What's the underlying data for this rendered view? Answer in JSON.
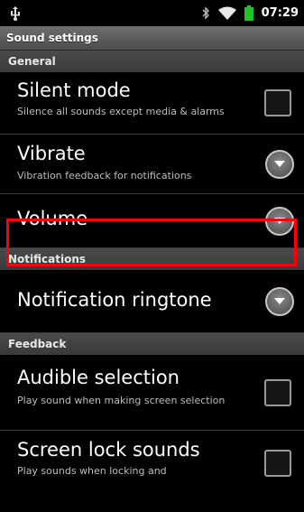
{
  "status_bar": {
    "time": "07:29",
    "icons": [
      "usb-icon",
      "bluetooth-icon",
      "wifi-icon",
      "battery-icon"
    ],
    "battery_color": "#22c322"
  },
  "title": "Sound settings",
  "sections": {
    "general": "General",
    "notifications": "Notifications",
    "feedback": "Feedback"
  },
  "items": {
    "silent_mode": {
      "title": "Silent mode",
      "summary": "Silence all sounds except media & alarms",
      "checked": false
    },
    "vibrate": {
      "title": "Vibrate",
      "summary": "Vibration feedback for notifications"
    },
    "volume": {
      "title": "Volume"
    },
    "notification_ringtone": {
      "title": "Notification ringtone"
    },
    "audible_selection": {
      "title": "Audible selection",
      "summary": "Play sound when making screen selection",
      "checked": false
    },
    "screen_lock_sounds": {
      "title": "Screen lock sounds",
      "summary": "Play sounds when locking and",
      "checked": false
    }
  },
  "highlight_color": "#ff0000"
}
